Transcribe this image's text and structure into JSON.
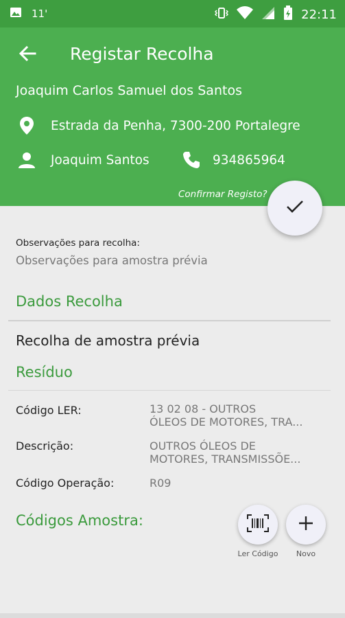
{
  "status_bar": {
    "signal_text": "11'",
    "time": "22:11"
  },
  "header": {
    "title": "Registar Recolha",
    "client_name": "Joaquim Carlos Samuel dos Santos",
    "address": "Estrada da Penha, 7300-200 Portalegre",
    "contact_name": "Joaquim Santos",
    "phone": "934865964",
    "confirm_label": "Confirmar Registo?"
  },
  "observations": {
    "label": "Observações para recolha:",
    "value": "Observações para amostra prévia"
  },
  "dados_recolha": {
    "title": "Dados Recolha",
    "type": "Recolha de amostra prévia"
  },
  "residuo": {
    "title": "Resíduo",
    "codigo_ler_label": "Código LER:",
    "codigo_ler_value_line1": "13 02 08 - OUTROS",
    "codigo_ler_value_line2": "ÓLEOS DE MOTORES, TRA...",
    "descricao_label": "Descrição:",
    "descricao_value_line1": "OUTROS ÓLEOS DE",
    "descricao_value_line2": "MOTORES, TRANSMISSÕE...",
    "codigo_operacao_label": "Código Operação:",
    "codigo_operacao_value": "R09"
  },
  "codigos_amostra": {
    "title": "Códigos Amostra:",
    "read_code_label": "Ler Código",
    "new_label": "Novo"
  },
  "colors": {
    "primary": "#4caf50",
    "status_bar": "#3e9e40",
    "accent_text": "#3a9a3c",
    "fab_bg": "#f0f0f8"
  }
}
